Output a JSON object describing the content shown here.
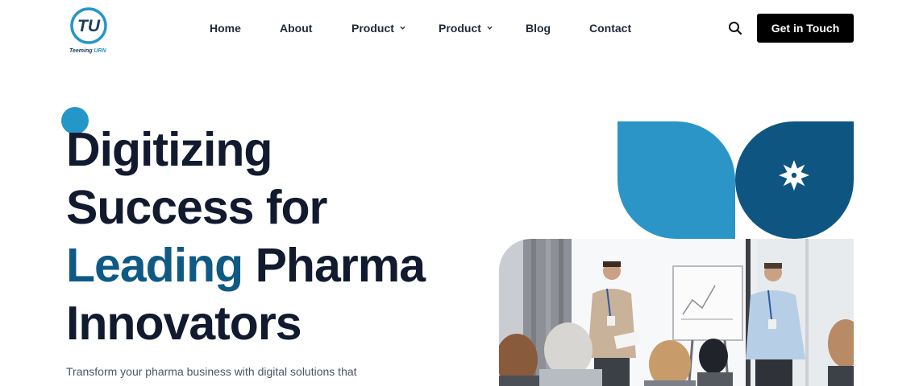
{
  "brand": {
    "logo_letters": "TU",
    "logo_text_a": "Teeming ",
    "logo_text_b": "URN"
  },
  "nav": {
    "items": [
      {
        "label": "Home",
        "has_dropdown": false
      },
      {
        "label": "About",
        "has_dropdown": false
      },
      {
        "label": "Product",
        "has_dropdown": true
      },
      {
        "label": "Product",
        "has_dropdown": true
      },
      {
        "label": "Blog",
        "has_dropdown": false
      },
      {
        "label": "Contact",
        "has_dropdown": false
      }
    ],
    "search_icon": "search-icon",
    "cta_label": "Get in Touch"
  },
  "hero": {
    "title_line1": "Digitizing",
    "title_line2": "Success for",
    "title_line3_highlight": "Leading",
    "title_line3_rest": " Pharma",
    "title_line4": "Innovators",
    "subtitle": "Transform your pharma business with digital solutions that"
  },
  "graphic": {
    "star_icon": "star-icon",
    "photo": "presentation-meeting-photo"
  },
  "colors": {
    "accent_light": "#2596c8",
    "accent_dark": "#0f5a84",
    "cta_bg": "#000000",
    "heading": "#111a2e"
  }
}
